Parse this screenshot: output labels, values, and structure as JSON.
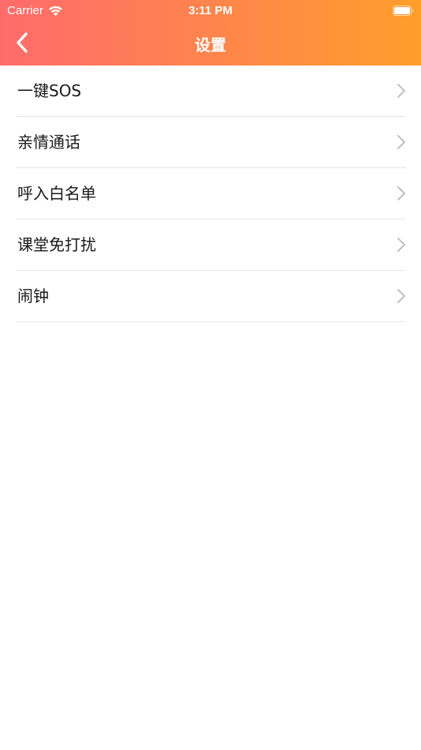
{
  "status_bar": {
    "carrier": "Carrier",
    "time": "3:11 PM"
  },
  "nav": {
    "title": "设置",
    "back_icon": "chevron-left-icon"
  },
  "settings": {
    "items": [
      {
        "label": "一键SOS"
      },
      {
        "label": "亲情通话"
      },
      {
        "label": "呼入白名单"
      },
      {
        "label": "课堂免打扰"
      },
      {
        "label": "闹钟"
      }
    ]
  },
  "colors": {
    "header_gradient_start": "#ff6b6b",
    "header_gradient_end": "#ff9e2a",
    "divider": "#e6e6e6",
    "chevron": "#b8b8b8"
  }
}
